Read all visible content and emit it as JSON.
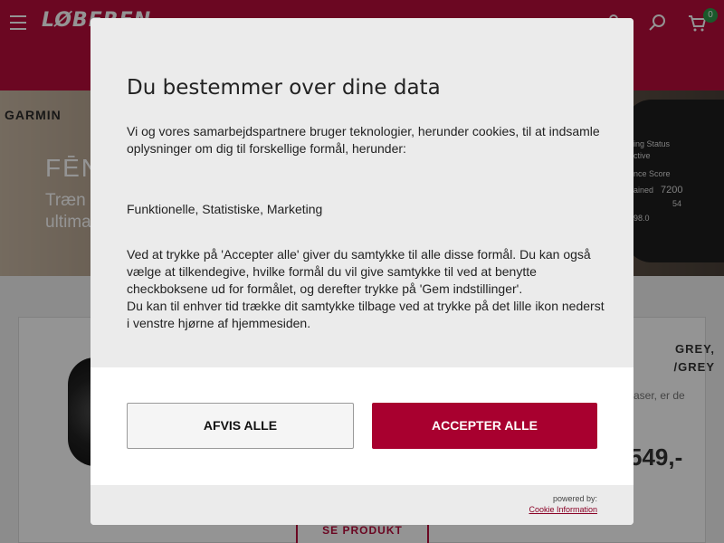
{
  "header": {
    "logo_text": "LØBEREN",
    "cart_count": "0",
    "icons": [
      "menu-icon",
      "user-icon",
      "search-icon",
      "cart-icon"
    ]
  },
  "banner": {
    "brand": "GARMIN",
    "title": "FĒNIX",
    "subtitle_line1": "Træn t",
    "subtitle_line2": "ultima",
    "watch_lines": [
      "ing Status",
      "ctive",
      "nce Score",
      "ained",
      "7200",
      "54",
      "98.0"
    ]
  },
  "product": {
    "name_line1": "GREY,",
    "name_line2": "/GREY",
    "desc": "aser, er de",
    "price": "549,-",
    "see_product": "SE PRODUKT"
  },
  "consent": {
    "title": "Du bestemmer over dine data",
    "intro": "Vi og vores samarbejdspartnere bruger teknologier, herunder cookies, til at indsamle oplysninger om dig til forskellige formål, herunder:",
    "purposes": "Funktionelle, Statistiske, Marketing",
    "details_1": "Ved at trykke på 'Accepter alle' giver du samtykke til alle disse formål. Du kan også vælge at tilkendegive, hvilke formål du vil give samtykke til ved at benytte checkboksene ud for formålet, og derefter trykke på 'Gem indstillinger'.",
    "details_2": "Du kan til enhver tid trække dit samtykke tilbage ved at trykke på det lille ikon nederst i venstre hjørne af hjemmesiden.",
    "reject_label": "AFVIS ALLE",
    "accept_label": "ACCEPTER ALLE",
    "powered_by": "powered by:",
    "cookie_info_link": "Cookie Information"
  },
  "colors": {
    "brand": "#b80d3c",
    "accept_button": "#a8002f",
    "cart_badge": "#2e9a4a"
  }
}
